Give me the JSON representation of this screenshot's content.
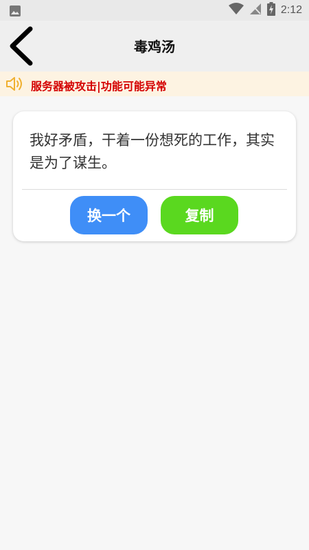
{
  "status_bar": {
    "time": "2:12",
    "icons": [
      "image-icon",
      "wifi-icon",
      "no-signal-icon",
      "battery-charging-icon"
    ]
  },
  "app_bar": {
    "title": "毒鸡汤",
    "back_icon": "chevron-left-icon"
  },
  "notice": {
    "icon": "speaker-icon",
    "text": "服务器被攻击|功能可能异常",
    "color": "#d40000",
    "background": "#fdf3e2"
  },
  "card": {
    "quote": "我好矛盾，干着一份想死的工作，其实是为了谋生。",
    "next_label": "换一个",
    "copy_label": "复制",
    "next_color": "#3f8ef7",
    "copy_color": "#5ad81f"
  }
}
